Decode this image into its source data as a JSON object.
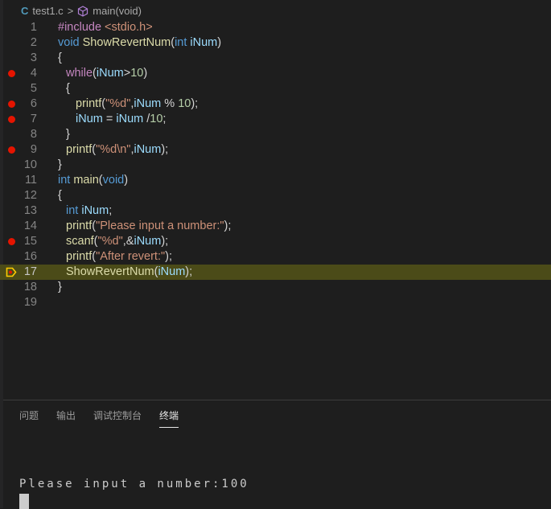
{
  "breadcrumb": {
    "file_icon": "C",
    "file": "test1.c",
    "separator": ">",
    "symbol_icon": "cube-icon",
    "symbol": "main(void)"
  },
  "editor": {
    "breakpoints": [
      4,
      6,
      7,
      9,
      15
    ],
    "current_line": 17,
    "lines": [
      {
        "n": "1",
        "indent": 0,
        "tokens": [
          [
            "ctl",
            "#include "
          ],
          [
            "str",
            "<stdio.h>"
          ]
        ]
      },
      {
        "n": "2",
        "indent": 0,
        "tokens": [
          [
            "kw",
            "void "
          ],
          [
            "fn",
            "ShowRevertNum"
          ],
          [
            "pl",
            "("
          ],
          [
            "kw",
            "int "
          ],
          [
            "var",
            "iNum"
          ],
          [
            "pl",
            ")"
          ]
        ]
      },
      {
        "n": "3",
        "indent": 0,
        "tokens": [
          [
            "pl",
            "{"
          ]
        ]
      },
      {
        "n": "4",
        "indent": 1,
        "tokens": [
          [
            "ctl",
            "while"
          ],
          [
            "pl",
            "("
          ],
          [
            "var",
            "iNum"
          ],
          [
            "pl",
            ">"
          ],
          [
            "num",
            "10"
          ],
          [
            "pl",
            ")"
          ]
        ]
      },
      {
        "n": "5",
        "indent": 1,
        "tokens": [
          [
            "pl",
            "{"
          ]
        ]
      },
      {
        "n": "6",
        "indent": 2,
        "tokens": [
          [
            "fn",
            "printf"
          ],
          [
            "pl",
            "("
          ],
          [
            "str",
            "\"%d\""
          ],
          [
            "pl",
            ","
          ],
          [
            "var",
            "iNum"
          ],
          [
            "pl",
            " % "
          ],
          [
            "num",
            "10"
          ],
          [
            "pl",
            ");"
          ]
        ]
      },
      {
        "n": "7",
        "indent": 2,
        "tokens": [
          [
            "var",
            "iNum"
          ],
          [
            "pl",
            " = "
          ],
          [
            "var",
            "iNum"
          ],
          [
            "pl",
            " /"
          ],
          [
            "num",
            "10"
          ],
          [
            "pl",
            ";"
          ]
        ]
      },
      {
        "n": "8",
        "indent": 1,
        "tokens": [
          [
            "pl",
            "}"
          ]
        ]
      },
      {
        "n": "9",
        "indent": 1,
        "tokens": [
          [
            "fn",
            "printf"
          ],
          [
            "pl",
            "("
          ],
          [
            "str",
            "\"%d\\n\""
          ],
          [
            "pl",
            ","
          ],
          [
            "var",
            "iNum"
          ],
          [
            "pl",
            ");"
          ]
        ]
      },
      {
        "n": "10",
        "indent": 0,
        "tokens": [
          [
            "pl",
            "}"
          ]
        ]
      },
      {
        "n": "11",
        "indent": 0,
        "tokens": [
          [
            "kw",
            "int "
          ],
          [
            "fn",
            "main"
          ],
          [
            "pl",
            "("
          ],
          [
            "kw",
            "void"
          ],
          [
            "pl",
            ")"
          ]
        ]
      },
      {
        "n": "12",
        "indent": 0,
        "tokens": [
          [
            "pl",
            "{"
          ]
        ]
      },
      {
        "n": "13",
        "indent": 1,
        "tokens": [
          [
            "kw",
            "int "
          ],
          [
            "var",
            "iNum"
          ],
          [
            "pl",
            ";"
          ]
        ]
      },
      {
        "n": "14",
        "indent": 1,
        "tokens": [
          [
            "fn",
            "printf"
          ],
          [
            "pl",
            "("
          ],
          [
            "str",
            "\"Please input a number:\""
          ],
          [
            "pl",
            ");"
          ]
        ]
      },
      {
        "n": "15",
        "indent": 1,
        "tokens": [
          [
            "fn",
            "scanf"
          ],
          [
            "pl",
            "("
          ],
          [
            "str",
            "\"%d\""
          ],
          [
            "pl",
            ",&"
          ],
          [
            "var",
            "iNum"
          ],
          [
            "pl",
            ");"
          ]
        ]
      },
      {
        "n": "16",
        "indent": 1,
        "tokens": [
          [
            "fn",
            "printf"
          ],
          [
            "pl",
            "("
          ],
          [
            "str",
            "\"After revert:\""
          ],
          [
            "pl",
            ");"
          ]
        ]
      },
      {
        "n": "17",
        "indent": 1,
        "tokens": [
          [
            "fn",
            "ShowRevertNum"
          ],
          [
            "pl",
            "("
          ],
          [
            "var",
            "iNum"
          ],
          [
            "pl",
            ");"
          ]
        ]
      },
      {
        "n": "18",
        "indent": 0,
        "tokens": [
          [
            "pl",
            "}"
          ]
        ]
      },
      {
        "n": "19",
        "indent": 0,
        "tokens": []
      }
    ]
  },
  "panel": {
    "tabs": [
      {
        "label": "问题"
      },
      {
        "label": "输出"
      },
      {
        "label": "调试控制台"
      },
      {
        "label": "终端",
        "active": true
      }
    ]
  },
  "terminal": {
    "output": "Please input a number:100"
  },
  "colors": {
    "breakpoint": "#e51400",
    "current_line_bg": "#4b4b18",
    "debug_arrow": "#ffcc00"
  }
}
